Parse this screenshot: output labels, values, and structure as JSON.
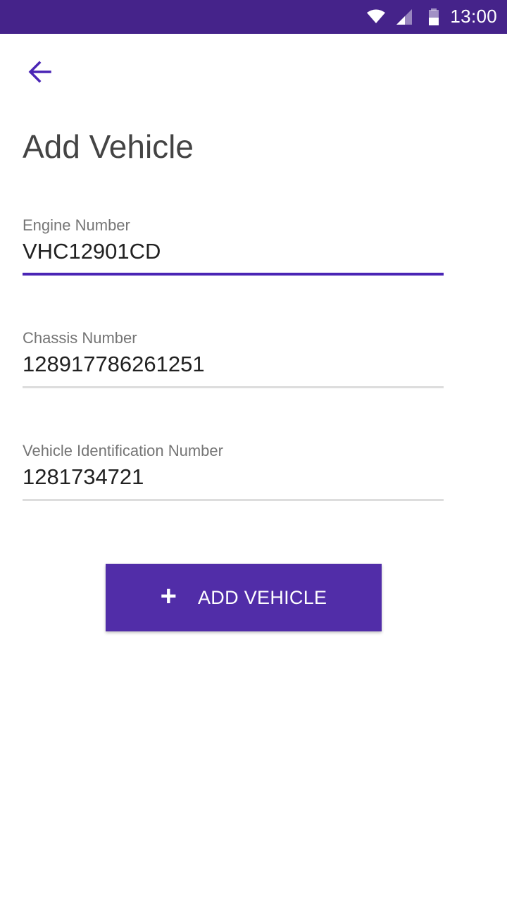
{
  "status_bar": {
    "time": "13:00",
    "icons": [
      "wifi-icon",
      "signal-icon",
      "battery-icon"
    ],
    "background": "#45238a"
  },
  "header": {
    "back_icon": "arrow-left-icon",
    "title": "Add Vehicle"
  },
  "form": {
    "fields": [
      {
        "label": "Engine Number",
        "value": "VHC12901CD",
        "focused": true
      },
      {
        "label": "Chassis Number",
        "value": "128917786261251",
        "focused": false
      },
      {
        "label": "Vehicle Identification Number",
        "value": "1281734721",
        "focused": false
      }
    ],
    "submit": {
      "icon": "plus-icon",
      "label": "ADD VEHICLE"
    }
  },
  "colors": {
    "accent": "#4a25b5",
    "button": "#512da8",
    "text": "#212121",
    "label": "#757575"
  }
}
